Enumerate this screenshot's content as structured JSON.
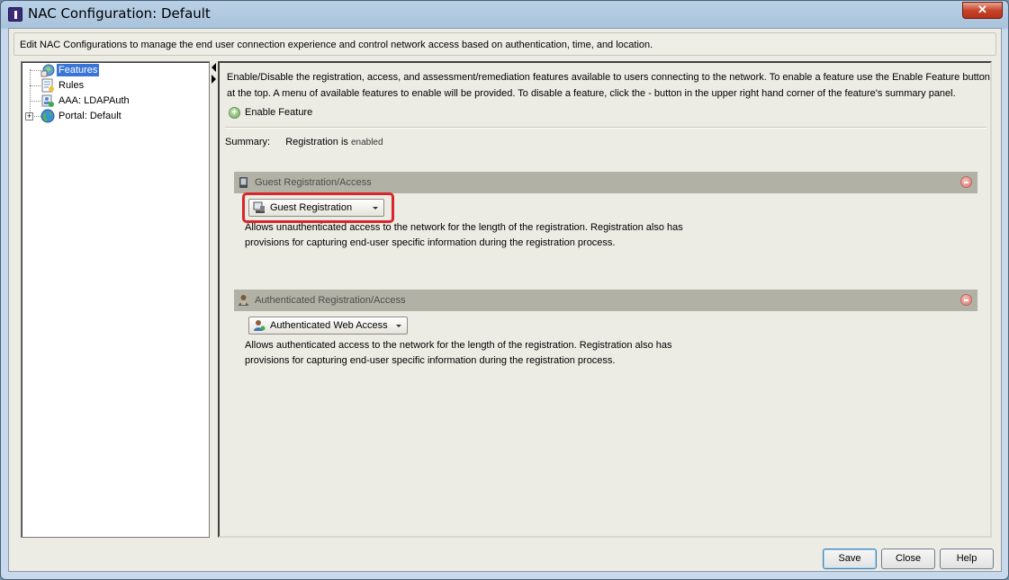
{
  "window": {
    "title": "NAC Configuration: Default",
    "close_label": "✕"
  },
  "description": "Edit NAC Configurations to manage the end user connection experience and control network access based on authentication, time, and location.",
  "tree": {
    "items": [
      {
        "label": "Features",
        "icon": "features-icon",
        "selected": true
      },
      {
        "label": "Rules",
        "icon": "rules-icon"
      },
      {
        "label": "AAA: LDAPAuth",
        "icon": "aaa-icon"
      },
      {
        "label": "Portal: Default",
        "icon": "globe-icon",
        "expandable": true
      }
    ],
    "expander": "+"
  },
  "content": {
    "intro": "Enable/Disable the registration, access, and assessment/remediation features available to users connecting to the network. To enable a feature use the Enable Feature button at the top. A menu of available features to enable will be provided. To disable a feature, click the - button in the upper right hand corner of the feature's summary panel.",
    "enable_feature": "Enable Feature",
    "summary_label": "Summary:",
    "summary_value": "Registration is",
    "summary_status": "enabled",
    "panels": [
      {
        "title": "Guest Registration/Access",
        "dropdown": "Guest Registration",
        "description": "Allows unauthenticated access to the network for the length of the registration. Registration also has provisions for capturing end-user specific information during the registration process."
      },
      {
        "title": "Authenticated Registration/Access",
        "dropdown": "Authenticated Web Access",
        "description": "Allows authenticated access to the network for the length of the registration. Registration also has provisions for capturing end-user specific information during the registration process."
      }
    ]
  },
  "footer": {
    "save": "Save",
    "close": "Close",
    "help": "Help"
  },
  "colors": {
    "selection": "#3875d7",
    "panel_header": "#b2b1a6",
    "highlight": "#d9262c",
    "remove_button": "#d9776e"
  }
}
